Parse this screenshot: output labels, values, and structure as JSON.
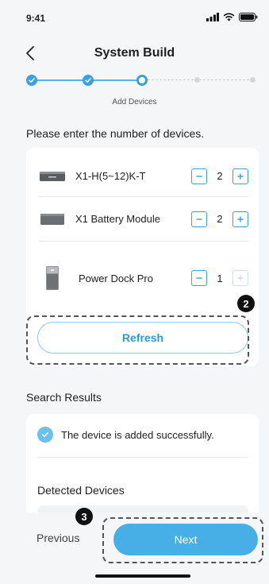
{
  "status_bar": {
    "time": "9:41"
  },
  "header": {
    "title": "System Build"
  },
  "stepper": {
    "current_step_label": "Add Devices"
  },
  "instruction": "Please enter the number of devices.",
  "devices": [
    {
      "name": "X1-H(5~12)K-T",
      "quantity": "2",
      "plus_enabled": true
    },
    {
      "name": "X1 Battery Module",
      "quantity": "2",
      "plus_enabled": true
    },
    {
      "name": "Power Dock Pro",
      "quantity": "1",
      "plus_enabled": false
    }
  ],
  "refresh_label": "Refresh",
  "annotations": {
    "refresh_badge": "2",
    "next_badge": "3"
  },
  "search_results": {
    "heading": "Search Results",
    "success_message": "The device is added successfully.",
    "detected_heading": "Detected Devices"
  },
  "footer": {
    "previous_label": "Previous",
    "next_label": "Next"
  },
  "colors": {
    "accent": "#3aa0de",
    "next_button": "#48aee6",
    "background": "#f5f6f8"
  }
}
